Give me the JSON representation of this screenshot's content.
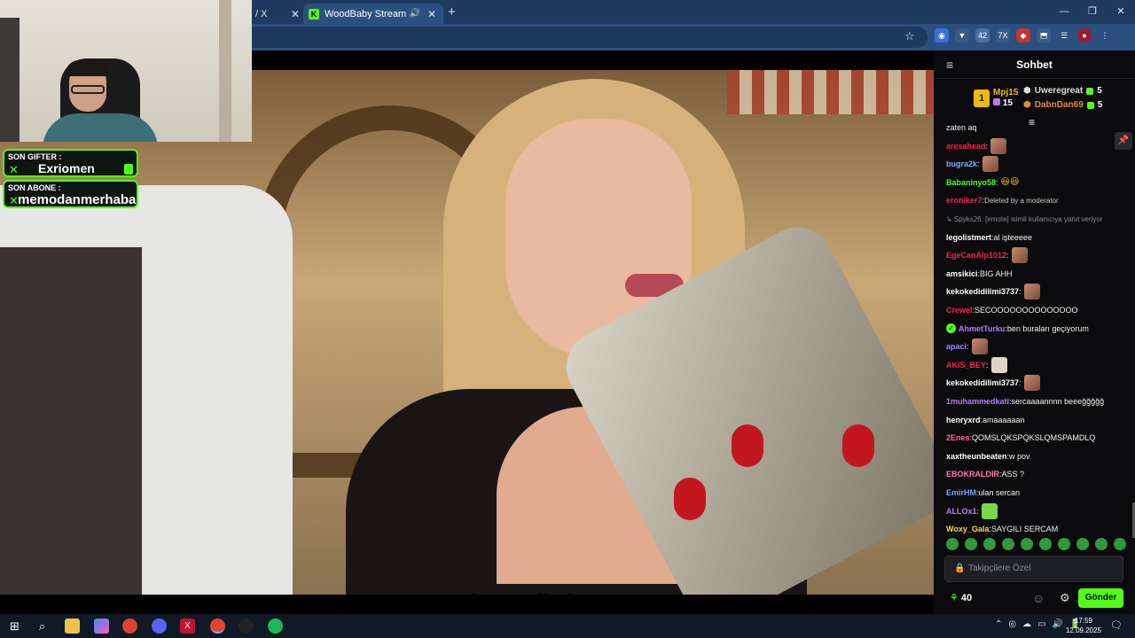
{
  "browser": {
    "tab1_title": "/ X",
    "tab2_title": "WoodBaby Stream - Watch",
    "tab2_favicon": "K",
    "new_tab": "+",
    "close_glyph": "✕",
    "speaker_glyph": "🔊",
    "min_glyph": "—",
    "restore_glyph": "❐",
    "close_window_glyph": "✕",
    "star_glyph": "☆",
    "extensions": [
      "◉",
      "▼",
      "42",
      "7X",
      "◆",
      "⬒",
      "☰",
      "●",
      "⋮"
    ]
  },
  "stream": {
    "handle": "onlywoodbaby",
    "socials": [
      "◎",
      "K",
      "♪",
      "t",
      "▶",
      "X"
    ]
  },
  "overlay": {
    "gifter_label": "SON GIFTER :",
    "gifter_name": "Exriomen",
    "sub_label": "SON ABONE :",
    "sub_name": "memodanmerhaba",
    "x_mark": "✕"
  },
  "chat": {
    "title": "Sohbet",
    "collapse_glyph": "≡",
    "pin_glyph": "📌",
    "pause_glyph": "≡",
    "leaderboard": {
      "rank": "1",
      "first": {
        "name": "Mpj15",
        "count": "15"
      },
      "second": {
        "name": "Uweregreat",
        "count": "5"
      },
      "third": {
        "name": "DabnDan69",
        "count": "5"
      }
    },
    "messages": [
      {
        "user": "",
        "text": "zaten aq"
      },
      {
        "user": "aresahead",
        "text": "",
        "emote": "face"
      },
      {
        "user": "bugra2k",
        "text": "",
        "emote": "face"
      },
      {
        "user": "Babaninyo58",
        "text": "",
        "smiley": "😃😃"
      },
      {
        "user": "eroniker7",
        "text": "",
        "deleted": "Deleted by a moderator"
      },
      {
        "user": "",
        "text": "",
        "reply": "↳ Spyks26: [emote] isimli kullanıcıya yanıt veriyor"
      },
      {
        "user": "legolistmert",
        "text": "al işteeeee"
      },
      {
        "user": "EgeCanAlp1012",
        "text": "",
        "emote": "face"
      },
      {
        "user": "amsikici",
        "text": "BIG AHH"
      },
      {
        "user": "kekokedidilimi3737",
        "text": "",
        "emote": "face"
      },
      {
        "user": "Crewel",
        "text": "SECOOOOOOOOOOOOOO"
      },
      {
        "user": "AhmetTurku",
        "text": "ben buraları geçiyorum",
        "mod": true
      },
      {
        "user": "apaci",
        "text": "",
        "emote": "face"
      },
      {
        "user": "AKIS_BEY",
        "text": "",
        "emote": "white"
      },
      {
        "user": "kekokedidilimi3737",
        "text": "",
        "emote": "face"
      },
      {
        "user": "1muhammedkati",
        "text": "sercaaaannnn beeeğğğğğ"
      },
      {
        "user": "henryxrd",
        "text": "amaaaaaan"
      },
      {
        "user": "2Enes",
        "text": "QOMSLQKSPQKSLQMSPAMDLQ"
      },
      {
        "user": "xaxtheunbeaten",
        "text": "w pov"
      },
      {
        "user": "EBOKRALDIR",
        "text": "ASS ?"
      },
      {
        "user": "EmirHM",
        "text": "ulan sercan"
      },
      {
        "user": "ALLOx1",
        "text": "",
        "emote": "green"
      },
      {
        "user": "Woxy_Gala",
        "text": "SAYGILI SERCAM"
      }
    ],
    "colors": [
      "#ffffff",
      "#ff1f4e",
      "#7fa8ff",
      "#53fc18",
      "#ff1f4e",
      "#8b8b93",
      "#ffffff",
      "#ff1f4e",
      "#ffffff",
      "#ffffff",
      "#ff1f4e",
      "#b57cff",
      "#9b8bff",
      "#ff1f4e",
      "#ffffff",
      "#b57cff",
      "#ffffff",
      "#ff6b8b",
      "#ffffff",
      "#ff7aa8",
      "#7fa8ff",
      "#b57cff",
      "#ffd84a"
    ],
    "input_placeholder": "Takipçilere Özel",
    "lock_glyph": "🔒",
    "points": "40",
    "points_glyph": "⚘",
    "gear_glyph": "⚙",
    "emote_glyph": "☺",
    "send_label": "Gönder"
  },
  "taskbar": {
    "time": "17:59",
    "date": "12.09.2025",
    "tray_glyphs": [
      "⌃",
      "◎",
      "☁",
      "▭",
      "🔊",
      "🔋"
    ],
    "notif_glyph": "🗨"
  }
}
